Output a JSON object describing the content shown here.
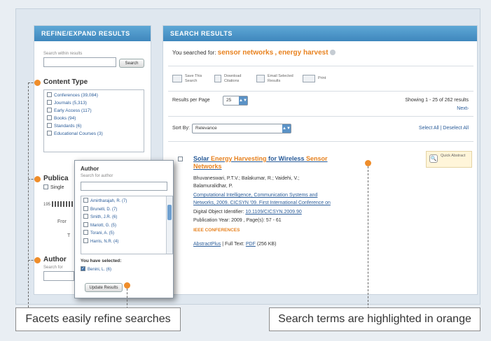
{
  "refine": {
    "header": "REFINE/EXPAND RESULTS",
    "search_within_label": "Search within results",
    "search_button": "Search",
    "content_type_title": "Content Type",
    "content_types": [
      "Conferences (39,084)",
      "Journals (5,313)",
      "Early Access (117)",
      "Books (94)",
      "Standards (6)",
      "Educational Courses (3)"
    ],
    "publication_title_partial": "Publica",
    "single_partial": "Single",
    "year_partial": "195",
    "from_partial": "Fror",
    "to_partial": "T",
    "author_title_partial": "Author",
    "author_search_partial": "Search for"
  },
  "author_popup": {
    "title": "Author",
    "search_placeholder": "Search for author",
    "authors": [
      "Amirtharajah, R. (7)",
      "Brunelli, D. (7)",
      "Smith, J.R. (6)",
      "Mariott, G. (5)",
      "Torani, A. (5)",
      "Harris, N.R. (4)"
    ],
    "selected_label": "You have selected:",
    "selected": [
      "Benini, L. (6)"
    ],
    "update_button": "Update Results"
  },
  "results": {
    "header": "SEARCH RESULTS",
    "searched_prefix": "You searched for:",
    "kw1": "sensor networks",
    "kw_sep": ",",
    "kw2": "energy harvest",
    "toolbar": {
      "save": "Save This Search",
      "download": "Download Citations",
      "email": "Email Selected Results",
      "print": "Print"
    },
    "per_page_label": "Results per Page",
    "per_page_value": "25",
    "showing": "Showing 1 - 25 of 262 results",
    "next": "Next›",
    "sort_label": "Sort By:",
    "sort_value": "Relevance",
    "select_all": "Select All",
    "deselect_all": "Deselect All",
    "item": {
      "title_a": "Solar ",
      "title_b": "Energy Harvesting",
      "title_c": " for Wireless ",
      "title_d": "Sensor",
      "title_e": "Networks",
      "authors_1": "Bhuvaneswari, P.T.V.; Balakumar, R.; Vaidehi, V.;",
      "authors_2": "Balamuralidhar, P.",
      "venue_1": "Computational Intelligence, Communication Systems and",
      "venue_2": "Networks, 2009. CICSYN '09. First International Conference on",
      "doi_label": "Digital Object Identifier:",
      "doi": "10.1109/CICSYN.2009.90",
      "year_pages": "Publication Year: 2009 , Page(s): 57 - 61",
      "category": "IEEE CONFERENCES",
      "abstract": "AbstractPlus",
      "fulltext_label": "Full Text:",
      "pdf": "PDF",
      "size": "(256 KB)",
      "quick": "Quick Abstract"
    }
  },
  "captions": {
    "left": "Facets easily refine searches",
    "right": "Search terms are highlighted in orange"
  }
}
